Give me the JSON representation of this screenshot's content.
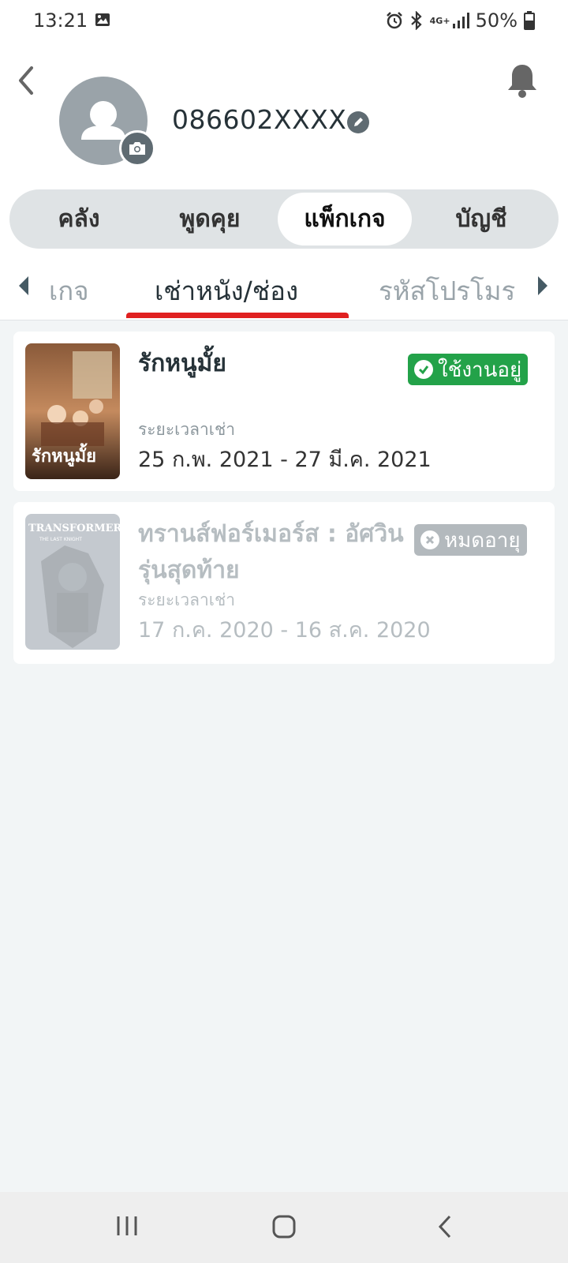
{
  "status_bar": {
    "time": "13:21",
    "network": "4G+",
    "battery": "50%"
  },
  "header": {
    "phone_number": "086602XXXX"
  },
  "main_tabs": [
    {
      "label": "คลัง",
      "active": false
    },
    {
      "label": "พูดคุย",
      "active": false
    },
    {
      "label": "แพ็กเกจ",
      "active": true
    },
    {
      "label": "บัญชี",
      "active": false
    }
  ],
  "sub_tabs": [
    {
      "label": "เกจ",
      "active": false
    },
    {
      "label": "เช่าหนัง/ช่อง",
      "active": true
    },
    {
      "label": "รหัสโปรโมร",
      "active": false
    }
  ],
  "rentals": [
    {
      "title": "รักหนูมั้ย",
      "poster_text": "รักหนูมั้ย",
      "period_label": "ระยะเวลาเช่า",
      "period": "25 ก.พ. 2021 - 27 มี.ค. 2021",
      "status": "ใช้งานอยู่",
      "status_color": "#23a249"
    },
    {
      "title": "ทรานส์ฟอร์เมอร์ส : อัศวินรุ่นสุดท้าย",
      "poster_text": "TRANSFORMERS",
      "poster_subtext": "THE LAST KNIGHT",
      "period_label": "ระยะเวลาเช่า",
      "period": "17 ก.ค. 2020 - 16 ส.ค. 2020",
      "status": "หมดอายุ",
      "status_color": "#b3b9bd"
    }
  ],
  "colors": {
    "accent": "#e02020",
    "background": "#f2f5f6"
  }
}
